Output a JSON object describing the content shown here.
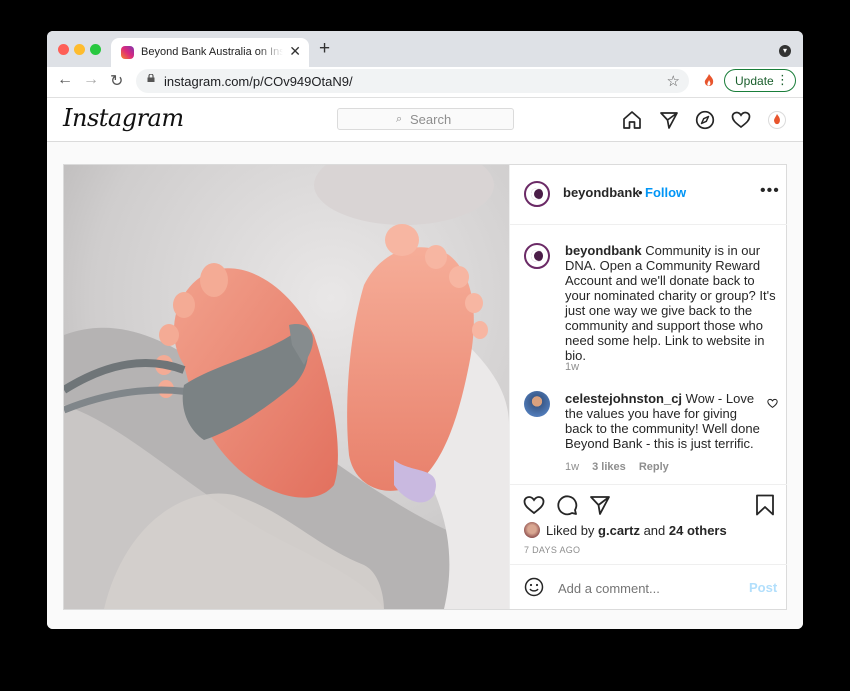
{
  "browser": {
    "tab_title": "Beyond Bank Australia on Instagram",
    "close_glyph": "✕",
    "new_tab_glyph": "+",
    "url": "instagram.com/p/COv949OtaN9/",
    "update_label": "Update",
    "nav": {
      "back": "←",
      "forward": "→",
      "reload": "↻"
    },
    "star_glyph": "☆",
    "menu_glyph": "⋮",
    "tab_menu_glyph": "▾"
  },
  "instagram": {
    "logo_text": "Instagram",
    "search_placeholder": "Search",
    "search_glyph": "⌕"
  },
  "post": {
    "author": "beyondbank",
    "separator": "•",
    "follow_label": "Follow",
    "more_glyph": "•••",
    "caption_text": "Community is in our DNA. Open a Community Reward Account and we'll donate back to your nominated charity or group? It's just one way we give back to the community and support those who need some help. Link to website in bio.",
    "caption_time": "1w",
    "comment": {
      "author": "celestejohnston_cj",
      "text": "Wow - Love the values you have for giving back to the community! Well done Beyond Bank - this is just terrific.",
      "time": "1w",
      "likes": "3 likes",
      "reply_label": "Reply"
    },
    "liked_by_prefix": "Liked by",
    "liked_by_user": "g.cartz",
    "liked_by_and": "and",
    "liked_by_others": "24 others",
    "date_label": "7 DAYS AGO",
    "add_comment_placeholder": "Add a comment...",
    "post_button": "Post"
  },
  "colors": {
    "accent_blue": "#0095f6",
    "brand_purple": "#6b2a66",
    "update_green": "#1a7e3a"
  }
}
